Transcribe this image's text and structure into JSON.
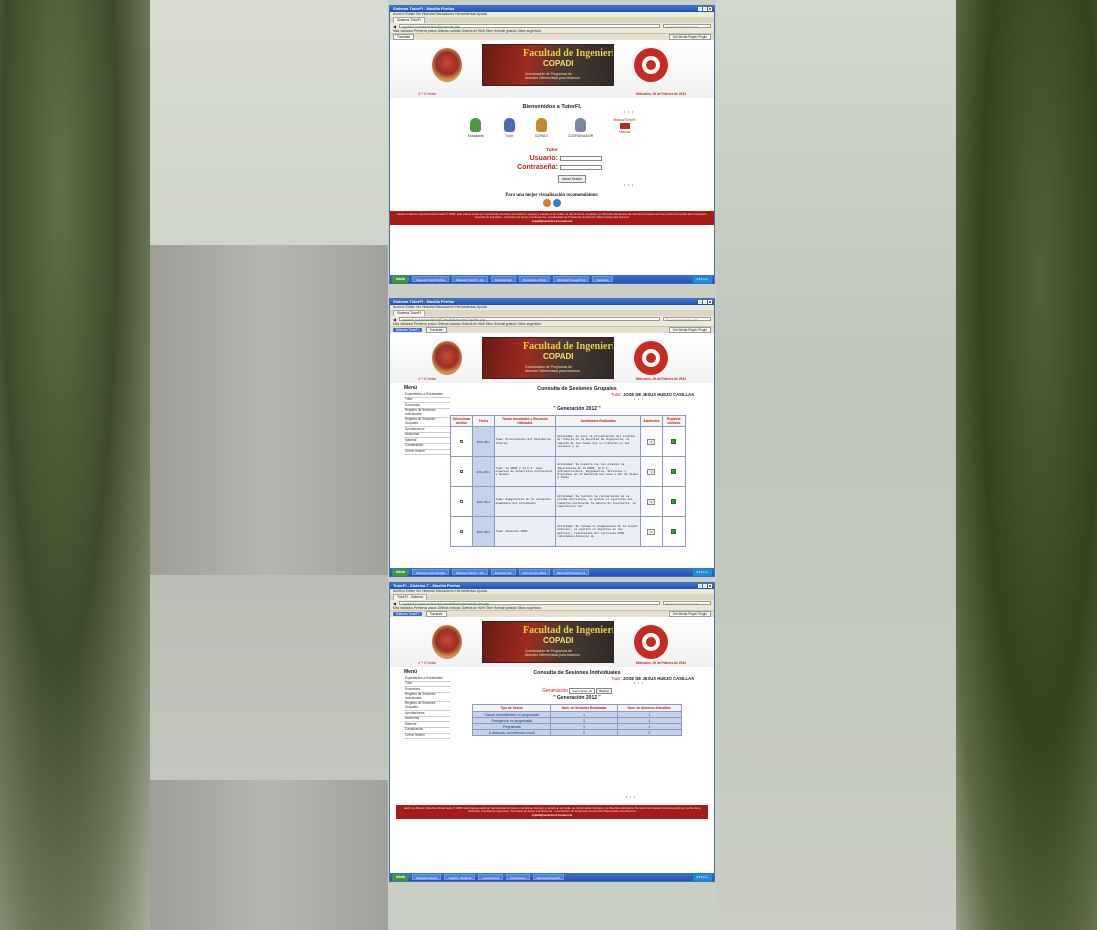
{
  "window_title": "Sistema TutorFI - Mozilla Firefox",
  "window_title2": "Sistema TutorFI - Mozilla Firefox",
  "window_title3": "TutorFI - Sistema T - Mozilla Firefox",
  "menu": "Archivo  Editar  Ver  Historial  Marcadores  Herramientas  Ayuda",
  "tab_label": "Sistema TutorFI",
  "tab_label3": "TutorFI - Sistema",
  "url1": "copadi.fi-b.unam.mx/tutorfi/consultas.php",
  "url2": "copadi.fi-b.unam.mx/tutorfi/ConsultaSesionesGrupales.php",
  "url3": "copadi.fi-b.unam.mx/tutorfi/ConsultaSesionesIndividuales.php",
  "search_placeholder": "Search with Ask Search",
  "bookmarks": "Más visitados   Primeros pasos   Últimas noticias   Galería de Web Slice   Hotmail gratuito   Sitios sugeridos",
  "toolbar2": {
    "pill": "Sistema TutorFI",
    "translate": "Translate",
    "btn": "Get Media Player Plugin"
  },
  "banner": {
    "title": "Facultad de Ingeniería",
    "subtitle": "COPADI",
    "line1": "Coordinación de Programas de",
    "line2": "Atención Diferenciada para Alumnos"
  },
  "visits": "4 ** 8 Visitas",
  "date": "Miércoles, 29 de Febrero de 2012",
  "welcome": "Bienvenidos a TutorFI.",
  "ornament": "• • •",
  "roles": [
    {
      "label": "Estudiante"
    },
    {
      "label": "Tutor"
    },
    {
      "label": "COPADI"
    },
    {
      "label": "COORDINADOR"
    }
  ],
  "manual": "Manual",
  "manual_top": "Manual TutorFI",
  "login": {
    "title": "Tutor",
    "user": "Usuario:",
    "pass": "Contraseña:",
    "button": "Iniciar Sesión"
  },
  "recommend": "Para una mejor visualización recomendamos:",
  "footer": {
    "line1": "Hecho en México, Derechos Reservados © 2008. Esta página puede ser reproducida con fines no lucrativos, siempre y cuando no se mutile, se cite la fuente completa y su dirección electrónica. De otra forma requiere",
    "line2": "permiso previo por escrito de la institución. Facultad de Ingeniería - Secretaría de Apoyo a la Docencia - Coordinación de Programas de Atención Diferenciada para Alumnos",
    "email": "copadi@servicios.fi-b.unam.mx"
  },
  "taskbar": {
    "start": "Inicio",
    "items": [
      "Sistema Tutor Mozilla",
      "Sistema TutorFI - Mo",
      "Ilustraciones",
      "Documento Word",
      "Microsoft PowerPoint",
      "Capturas"
    ],
    "items3": [
      "Sistema TutorFI",
      "TutorFI - Sistema",
      "Ilustraciones",
      "Documento",
      "Microsoft PowerP"
    ],
    "tray": "9:15 p.m."
  },
  "menu_side": {
    "title": "Menú",
    "items": [
      "Expedientes a Estudiantes",
      "Tutor",
      "Encuestas",
      "Registro de Sesiones Individuales",
      "Registro de Sesiones Grupales",
      "Aprobaciones",
      "Asesorías",
      "Material",
      "Canalización",
      "Cerrar Sesión"
    ]
  },
  "grupales": {
    "title": "Consulta de Sesiones Grupales",
    "tutor_label": "Tutor:",
    "tutor_name": "JOSE DE JESUS HUEZO CASILLAS",
    "generation": "\" Generación 2012 \"",
    "headers": [
      "Seleccionar archivo",
      "Fecha",
      "Temas Abordados y Recursos Utilizados",
      "Actividades Realizadas",
      "Asistentes",
      "Registrar cambios"
    ],
    "rows": [
      {
        "date": "2011-08-1",
        "topic": "Tema: Presentación del Sistema de Tutoría",
        "activity": "Actividad: Se hizo la presentación del sistema de Tutoría en la Facultad de Ingeniería, se comento de los temas que se tratarán en las sesiones y se",
        "assist": "V"
      },
      {
        "date": "2011-08-1",
        "topic": "Tema: La UNAM y la F.I. como espacios de desarrollo profesional y humano.",
        "activity": "Actividad: Se comento con los alumnos la importancia de la UNAM, la F.I., Infraestructura, Reglamentos, Servicios y Programas de la Facultad así como a dar de Video a todos",
        "assist": "V"
      },
      {
        "date": "2011-08-2",
        "topic": "Tema: Diagnóstico de la situación académica del estudiante",
        "activity": "Actividad: Se realizó la recuperación de la prueba entrevista, se aplicó el ejercicio del cuaderno explicando la manera de resolverlo, se completaron los",
        "assist": "V"
      },
      {
        "date": "2011-08-3",
        "topic": "Tema: Análisis FODA",
        "activity": "Actividad: Se retomó el diagnóstico de la sesión anterior, se explicó el objetivo de las matrices, realización del ejercicio FODA individual.Análisis de",
        "assist": "V"
      }
    ]
  },
  "individuales": {
    "title": "Consulta de Sesiones Individuales",
    "tutor_label": "Tutor:",
    "tutor_name": "JOSE DE JESUS HUEZO CASILLAS",
    "gen_label": "Generación",
    "gen_select": "Generación 20",
    "gen_button": "Buscar",
    "generation": "\" Generación 2012 \"",
    "headers": [
      "Tipo de Sesión",
      "Núm. de Sesiones Realizadas",
      "Núm. de Alumnos Atendidos"
    ],
    "rows": [
      {
        "type": "Casual, circunstancial, no programada",
        "sessions": "1",
        "students": "1"
      },
      {
        "type": "Emergencia, no programada",
        "sessions": "1",
        "students": "1"
      },
      {
        "type": "Programada",
        "sessions": "1",
        "students": "1"
      },
      {
        "type": "A distancia, vía telefónica o mail",
        "sessions": "0",
        "students": "0"
      }
    ]
  },
  "colors": {
    "red": "#b3271c",
    "footer": "#a71a15",
    "link_blue": "#1d2f6c"
  }
}
